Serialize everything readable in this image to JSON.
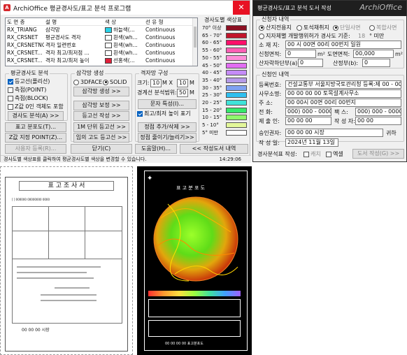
{
  "dialog1": {
    "title": "ArchiOffice 평균경사도/표고 분석 프로그램",
    "close_glyph": "✕",
    "layer_headers": [
      "도 면 층",
      "설 명",
      "색 상",
      "선 유 형"
    ],
    "layers": [
      {
        "name": "RX_TRIANG",
        "desc": "삼각망",
        "color_label": "하늘색(...",
        "swatch": "#29d3e8",
        "linetype": "Continuous"
      },
      {
        "name": "RX_CRSNET",
        "desc": "평균경사도 격자",
        "color_label": "흰색(wh...",
        "swatch": "#ffffff",
        "linetype": "Continuous"
      },
      {
        "name": "RX_CRSNETNO",
        "desc": "격자 일련번호",
        "color_label": "흰색(wh...",
        "swatch": "#ffffff",
        "linetype": "Continuous"
      },
      {
        "name": "RX_CRSNET...",
        "desc": "격자 최고/최저점 ...",
        "color_label": "흰색(wh...",
        "swatch": "#ffffff",
        "linetype": "Continuous"
      },
      {
        "name": "RX_CRSNET...",
        "desc": "격자 최고/최저 높이",
        "color_label": "선홍색(...",
        "swatch": "#e0203a",
        "linetype": "Continuous"
      }
    ],
    "legend_title": "경사도별 색상표",
    "legend": [
      {
        "label": "70° 이상",
        "color": "#8b0f22"
      },
      {
        "label": "65 - 70°",
        "color": "#c2142b"
      },
      {
        "label": "60 - 65°",
        "color": "#ff0f6a"
      },
      {
        "label": "55 - 60°",
        "color": "#ff5fb4"
      },
      {
        "label": "50 - 55°",
        "color": "#ff8ed9"
      },
      {
        "label": "45 - 50°",
        "color": "#e26cf2"
      },
      {
        "label": "40 - 45°",
        "color": "#c58bf7"
      },
      {
        "label": "35 - 40°",
        "color": "#b69be8"
      },
      {
        "label": "30 - 35°",
        "color": "#7fa2f2"
      },
      {
        "label": "25 - 30°",
        "color": "#2fc0f0"
      },
      {
        "label": "20 - 25°",
        "color": "#3fe3d9"
      },
      {
        "label": "15 - 20°",
        "color": "#35e86b"
      },
      {
        "label": "10 - 15°",
        "color": "#8ff76c"
      },
      {
        "label": "5 - 10°",
        "color": "#e3f79a"
      },
      {
        "label": "5° 미만",
        "color": "#ffffff"
      }
    ],
    "slope_group": {
      "title": "평균경사도 분석",
      "opt1": "등고선(폴리선)",
      "opt2": "측점(POINT)",
      "opt3": "측점(BLOCK)",
      "opt4": "Z값 0인 객체도 포함",
      "btn": "경사도 분석(A) >>"
    },
    "tri_group": {
      "title": "삼각망 생성",
      "r1": "3DFACE",
      "r2": "SOLID",
      "btn_create": "삼각망 생성 >>",
      "btn_edit": "삼각망 보정 >>",
      "btn_contour": "등고선 작성 >>",
      "btn_1m": "1M 단위 등고선 >>",
      "btn_any": "임의 고도 등고선 >>"
    },
    "grid_group": {
      "title": "격자망 구성",
      "size_label": "크기:",
      "size_x": "10",
      "x_sep": "M  X",
      "size_y": "10",
      "unit_m": "M",
      "range_label": "경계선 분석범위:",
      "range_val": "50",
      "btn_text": "문자 특성(I)...",
      "chk_minmax": "최고/최저 높이 표기",
      "btn_point": "정점 추가/삭제 >>",
      "btn_zoom": "정점 줄이기/늘리기>>"
    },
    "btn_profile": "표고 분포도(T)...",
    "btn_zpoint": "Z값 지정 POINT(Z)...",
    "btn_user": "사용자 등록(R)...",
    "btn_close": "닫기(C)",
    "btn_help": "도움말(H)...",
    "btn_report": "<< 작성도서 내역",
    "status": "경사도별 색상표를 클릭하여 평균경사도별 색상을 변경할 수 있습니다.",
    "time": "14:29:06"
  },
  "dialog2": {
    "title": "평균경사도/표고 분석 도서 작성",
    "brand": "ArchiOffice",
    "applicant_group": "신청자 내역",
    "r_mountain": "산지전용지",
    "r_soil": "토석채취지",
    "r_complex": "단일사면",
    "r_complex2": "복합사면",
    "r_local": "지자체별 개발행위허가 경사도 기준:",
    "local_val": "18",
    "local_unit": "° 미만",
    "loc_label": "소 재 지:",
    "loc_val": "00 시 00면 00리 00번지 일원",
    "area_label": "신청면적:",
    "area_val": "0",
    "area_unit": "m²",
    "plan_label": "도면면적:",
    "plan_val": "00,000",
    "plan_unit": "m²",
    "ridge_label": "산자락하단부(a):",
    "ridge_val": "0",
    "ridge_label2": "산정부(b):",
    "ridge_val2": "0",
    "apply_group": "신청인 내역",
    "reg_label": "등록번호:",
    "reg_val": "건설교통부 서울지방국토관리청 등록:제 00 - 00",
    "office_label": "사무소명:",
    "office_val": "00 00 00 00 토목설계사무소",
    "addr_label": "주    소:",
    "addr_val": "00 00시 00면 00리 00번지",
    "tel_label": "전    화:",
    "tel_val": "000) 000 - 0000",
    "fax_label": "팩    스:",
    "fax_val": "000) 000 - 0000",
    "author_label": "제 출 인:",
    "author_val": "00 00 00",
    "writer_label": "작 성 자:",
    "writer_val": "00 00",
    "approve_label": "승인권자:",
    "approve_val": "00 00 00 시장",
    "approve_suffix": "귀하",
    "date_label": "작 성 일:",
    "date_val": "2024년 11월 13일",
    "output_label": "경사분석표 작성:",
    "out1": "캐치",
    "out2": "엑셀",
    "btn_make": "도서 작성(G) >>"
  },
  "doc_left": {
    "title": "표 고 조 사 서",
    "line1": "[ ] 000000 00000000 0000",
    "foot": "00 00 00 시장"
  },
  "doc_right": {
    "title": "표 고 분 포 도",
    "caption": "00 00 00 00 표고분포도"
  }
}
